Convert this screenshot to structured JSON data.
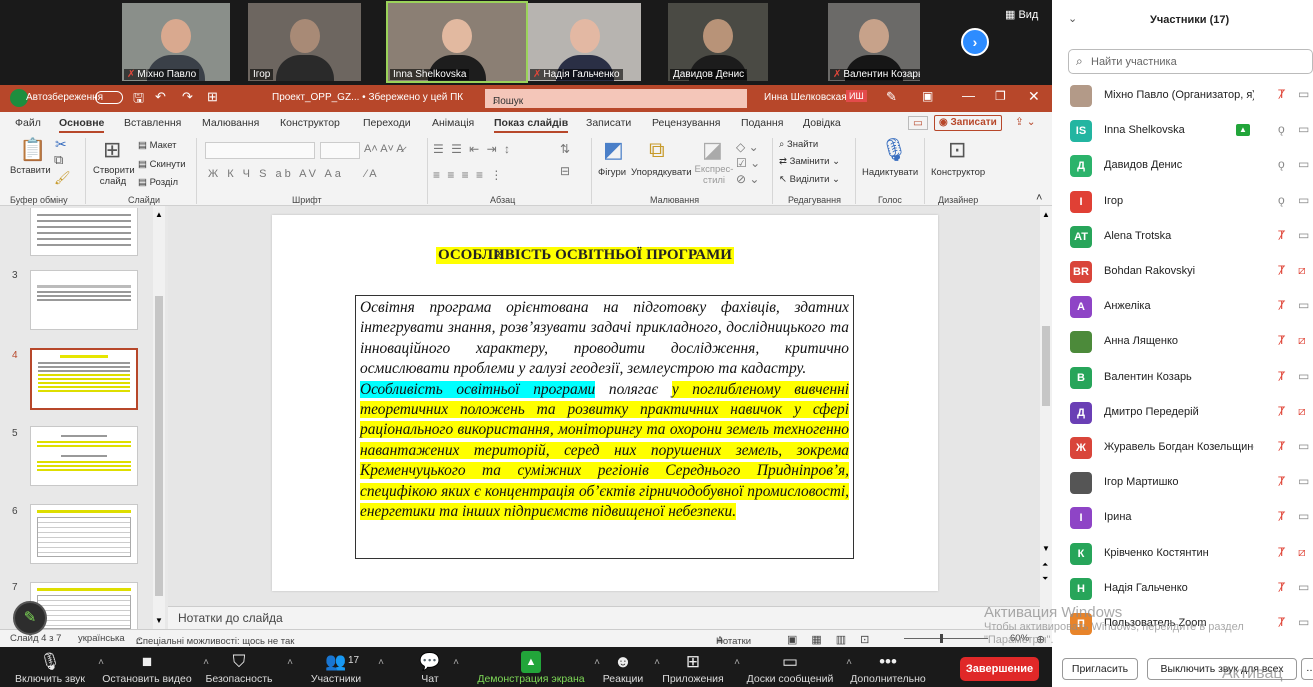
{
  "video": {
    "view_label": "Вид",
    "tiles": [
      {
        "name": "Міхно Павло",
        "muted": true,
        "bg": "#8a8f8a",
        "skin": "#d9a98f",
        "shirt": "#3a4048"
      },
      {
        "name": "Ігор",
        "muted": false,
        "bg": "#6d6660",
        "skin": "#a88a76",
        "shirt": "#2a2a2a"
      },
      {
        "name": "Inna Shelkovska",
        "muted": false,
        "bg": "#8b7f74",
        "skin": "#e2b9a0",
        "shirt": "#1d1d1d"
      },
      {
        "name": "Надія Гальченко",
        "muted": true,
        "bg": "#b7b4b0",
        "skin": "#e3b8a3",
        "shirt": "#2a2f45"
      },
      {
        "name": "Давидов Денис",
        "muted": false,
        "bg": "#4a4a44",
        "skin": "#b89378",
        "shirt": "#1c1c1c"
      },
      {
        "name": "Валентин Козарь",
        "muted": true,
        "bg": "#6b6a68",
        "skin": "#c7a28a",
        "shirt": "#161616"
      }
    ]
  },
  "ppt": {
    "autosave": "Автозбереження",
    "doc_title": "Проект_OPP_GZ... • Збережено у цей ПК",
    "search": "Пошук",
    "user": "Инна Шелковская",
    "user_initials": "ИШ",
    "tabs": [
      "Файл",
      "Основне",
      "Вставлення",
      "Малювання",
      "Конструктор",
      "Переходи",
      "Анімація",
      "Показ слайдів",
      "Записати",
      "Рецензування",
      "Подання",
      "Довідка"
    ],
    "record_button": "Записати",
    "ribbon": {
      "paste": "Вставити",
      "clipboard": "Буфер обміну",
      "new_slide": "Створити слайд",
      "layout": "Макет",
      "reset": "Скинути",
      "section": "Розділ",
      "slides_group": "Слайди",
      "font_group": "Шрифт",
      "paragraph_group": "Абзац",
      "shapes": "Фігури",
      "arrange": "Упорядкувати",
      "quick_styles": "Експрес-стилі",
      "drawing_group": "Малювання",
      "find": "Знайти",
      "replace": "Замінити",
      "select": "Виділити",
      "editing_group": "Редагування",
      "dictate": "Надиктувати",
      "voice_group": "Голос",
      "designer": "Конструктор",
      "designer_group": "Дизайнер"
    },
    "slide_numbers": [
      "3",
      "4",
      "5",
      "6",
      "7"
    ],
    "slide": {
      "title": "ОСОБЛИВІСТЬ ОСВІТНЬОЇ ПРОГРАМИ",
      "para1": "Освітня програма орієнтована на підготовку фахівців, здатних інтегрувати знання, розв’язувати задачі прикладного, дослідницького та інноваційного характеру, проводити дослідження, критично осмислювати проблеми у галузі геодезії, землеустрою та кадастру.",
      "para2_lead": "Особливість освітньої програми",
      "para2_mid": " полягає ",
      "para2_rest": "у поглибленому вивченні теоретичних положень та розвитку практичних навичок у сфері раціонального використання, моніторингу та охорони земель техногенно навантажених територій, серед них порушених земель, зокрема Кременчуцького та суміжних регіонів Середнього Придніпров’я, специфікою яких є концентрація об’єктів гірничодобувної промисловості, енергетики та інших підприємств підвищеної небезпеки."
    },
    "notes": "Нотатки до слайда",
    "status": {
      "slide_of": "Слайд 4 з 7",
      "language": "українська",
      "accessibility": "Спеціальні можливості: щось не так",
      "notes_btn": "Нотатки",
      "zoom": "60%"
    }
  },
  "zoom": {
    "toolbar": [
      {
        "label": "Включить звук",
        "icon": "🎙"
      },
      {
        "label": "Остановить видео",
        "icon": "■"
      },
      {
        "label": "Безопасность",
        "icon": "⛉"
      },
      {
        "label": "Участники",
        "icon": "👥",
        "count": "17"
      },
      {
        "label": "Чат",
        "icon": "💬"
      },
      {
        "label": "Демонстрация экрана",
        "icon": "▲"
      },
      {
        "label": "Реакции",
        "icon": "☻"
      },
      {
        "label": "Приложения",
        "icon": "⊞"
      },
      {
        "label": "Доски сообщений",
        "icon": "▭"
      },
      {
        "label": "Дополнительно",
        "icon": "•••"
      }
    ],
    "end_button": "Завершение"
  },
  "participants": {
    "title": "Участники (17)",
    "search_placeholder": "Найти участника",
    "list": [
      {
        "name": "Міхно Павло (Организатор, я)",
        "avatar": "",
        "color": "#b39a88",
        "mic": "off",
        "cam": "on"
      },
      {
        "name": "Inna Shelkovska",
        "avatar": "IS",
        "color": "#23b5a1",
        "mic": "on",
        "cam": "on",
        "sharing": true
      },
      {
        "name": "Давидов Денис",
        "avatar": "Д",
        "color": "#2bb36b",
        "mic": "on",
        "cam": "on"
      },
      {
        "name": "Ігор",
        "avatar": "І",
        "color": "#e04035",
        "mic": "on",
        "cam": "on"
      },
      {
        "name": "Alena Trotska",
        "avatar": "AT",
        "color": "#27a55a",
        "mic": "off",
        "cam": "on"
      },
      {
        "name": "Bohdan Rakovskyi",
        "avatar": "BR",
        "color": "#d9453a",
        "mic": "off",
        "cam": "off"
      },
      {
        "name": "Анжеліка",
        "avatar": "А",
        "color": "#8e44c6",
        "mic": "off",
        "cam": "on"
      },
      {
        "name": "Анна Лященко",
        "avatar": "",
        "color": "#4c8a3a",
        "mic": "off",
        "cam": "off"
      },
      {
        "name": "Валентин Козарь",
        "avatar": "В",
        "color": "#27a55a",
        "mic": "off",
        "cam": "on"
      },
      {
        "name": "Дмитро Передерій",
        "avatar": "Д",
        "color": "#6a3fb5",
        "mic": "off",
        "cam": "off"
      },
      {
        "name": "Журавель Богдан Козельщинсь...",
        "avatar": "Ж",
        "color": "#d9453a",
        "mic": "off",
        "cam": "on"
      },
      {
        "name": "Ігор Мартишко",
        "avatar": "",
        "color": "#555555",
        "mic": "off",
        "cam": "on"
      },
      {
        "name": "Ірина",
        "avatar": "І",
        "color": "#8e44c6",
        "mic": "off",
        "cam": "on"
      },
      {
        "name": "Крівченко Костянтин",
        "avatar": "К",
        "color": "#27a55a",
        "mic": "off",
        "cam": "off"
      },
      {
        "name": "Надія Гальченко",
        "avatar": "Н",
        "color": "#27a55a",
        "mic": "off",
        "cam": "on"
      },
      {
        "name": "Пользователь Zoom",
        "avatar": "П",
        "color": "#e8842a",
        "mic": "off",
        "cam": "on"
      }
    ],
    "invite": "Пригласить",
    "mute_all": "Выключить звук для всех"
  },
  "watermark": {
    "line1": "Активация Windows",
    "line2": "Чтобы активировать Windows, перейдите в раздел",
    "line3": "\"Параметры\".",
    "partial": "Активац"
  }
}
